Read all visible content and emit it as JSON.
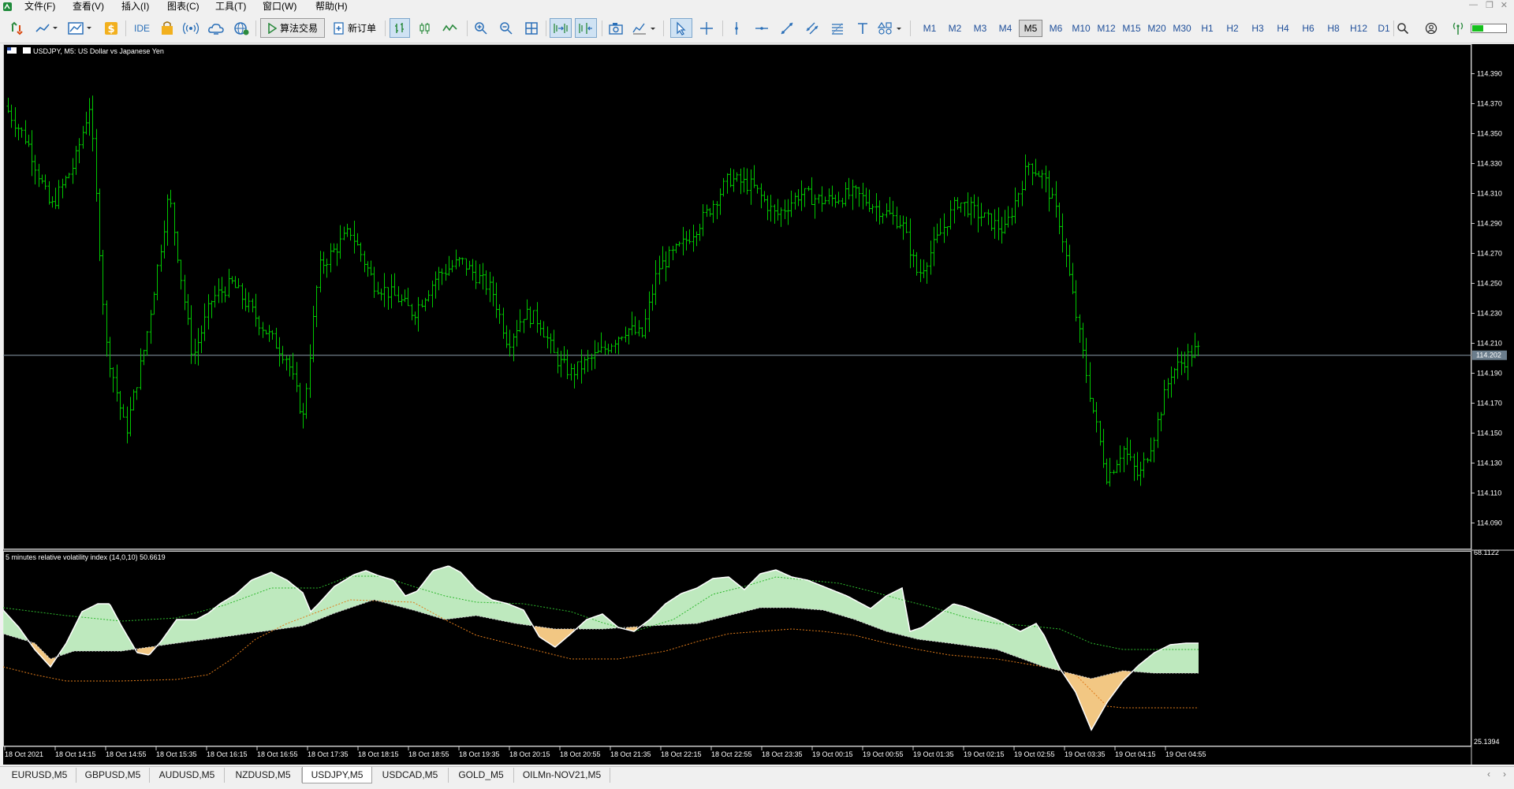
{
  "menu": [
    "文件(F)",
    "查看(V)",
    "插入(I)",
    "图表(C)",
    "工具(T)",
    "窗口(W)",
    "帮助(H)"
  ],
  "toolbar": {
    "ide_label": "IDE",
    "algo_label": "算法交易",
    "new_order_label": "新订单",
    "timeframes": [
      "M1",
      "M2",
      "M3",
      "M4",
      "M5",
      "M6",
      "M10",
      "M12",
      "M15",
      "M20",
      "M30",
      "H1",
      "H2",
      "H3",
      "H4",
      "H6",
      "H8",
      "H12",
      "D1"
    ],
    "active_timeframe": "M5"
  },
  "chart": {
    "symbol_title": "USDJPY, M5:  US Dollar vs Japanese Yen",
    "bar_color": "#00c800",
    "price_axis": [
      "114.390",
      "114.370",
      "114.350",
      "114.330",
      "114.310",
      "114.290",
      "114.270",
      "114.250",
      "114.230",
      "114.210",
      "114.190",
      "114.170",
      "114.150",
      "114.130",
      "114.110",
      "114.090"
    ],
    "current_price": "114.202",
    "time_axis": [
      "18 Oct 2021",
      "18 Oct 14:15",
      "18 Oct 14:55",
      "18 Oct 15:35",
      "18 Oct 16:15",
      "18 Oct 16:55",
      "18 Oct 17:35",
      "18 Oct 18:15",
      "18 Oct 18:55",
      "18 Oct 19:35",
      "18 Oct 20:15",
      "18 Oct 20:55",
      "18 Oct 21:35",
      "18 Oct 22:15",
      "18 Oct 22:55",
      "18 Oct 23:35",
      "19 Oct 00:15",
      "19 Oct 00:55",
      "19 Oct 01:35",
      "19 Oct 02:15",
      "19 Oct 02:55",
      "19 Oct 03:35",
      "19 Oct 04:15",
      "19 Oct 04:55"
    ]
  },
  "indicator": {
    "title": "5 minutes relative volatility index (14,0,10) 50.6619",
    "axis_top": "68.1122",
    "axis_bottom": "25.1394",
    "up_color": "#c8f5c8",
    "down_color": "#ffd28a",
    "upper_band_color": "#2db82d",
    "lower_band_color": "#e07b1a",
    "main_line_color": "#ffffff"
  },
  "tabs": [
    "EURUSD,M5",
    "GBPUSD,M5",
    "AUDUSD,M5",
    "NZDUSD,M5",
    "USDJPY,M5",
    "USDCAD,M5",
    "GOLD_M5",
    "OILMn-NOV21,M5"
  ],
  "active_tab": "USDJPY,M5"
}
